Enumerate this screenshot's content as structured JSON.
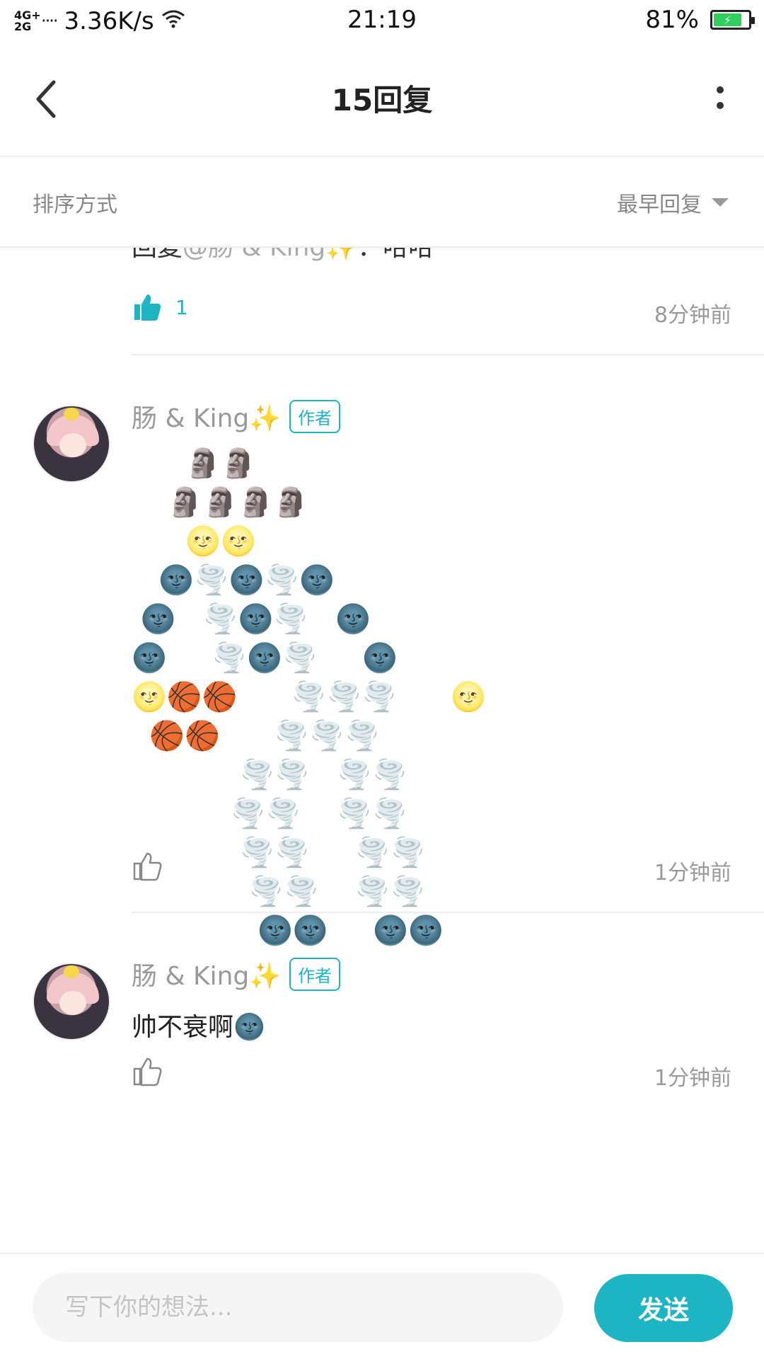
{
  "status_bar": {
    "network_gen": "4G+\n2G",
    "signal_bars": "‧‧‧‧",
    "speed": "3.36K/s",
    "time": "21:19",
    "battery_percent": "81%",
    "battery_level": 0.81,
    "battery_color": "#2fcf5c"
  },
  "nav": {
    "title": "15回复",
    "back_icon": "back-chevron-icon",
    "more_icon": "more-vertical-icon"
  },
  "sort": {
    "label": "排序方式",
    "selected": "最早回复"
  },
  "partial_reply": {
    "text_prefix": "回复",
    "mention": "@肠 & King✨",
    "text_suffix": "：哈哈",
    "likes": "1",
    "time": "8分钟前"
  },
  "replies": [
    {
      "username": "肠 & King✨",
      "badge": "作者",
      "art": "      🗿🗿\n    🗿🗿🗿🗿\n      🌝🌝\n   🌚🌪️🌚🌪️🌚\n 🌚   🌪️🌚🌪️   🌚\n🌚     🌪️🌚🌪️     🌚\n🌝🏀🏀      🌪️🌪️🌪️      🌝\n  🏀🏀      🌪️🌪️🌪️\n            🌪️🌪️   🌪️🌪️\n           🌪️🌪️    🌪️🌪️\n            🌪️🌪️     🌪️🌪️\n             🌪️🌪️    🌪️🌪️\n              🌚🌚     🌚🌚",
      "time": "1分钟前"
    },
    {
      "username": "肠 & King✨",
      "badge": "作者",
      "text": "帅不衰啊🌚",
      "time": "1分钟前"
    }
  ],
  "input": {
    "placeholder": "写下你的想法...",
    "send_label": "发送"
  },
  "colors": {
    "accent": "#1db4c4",
    "muted_text": "#999999"
  }
}
